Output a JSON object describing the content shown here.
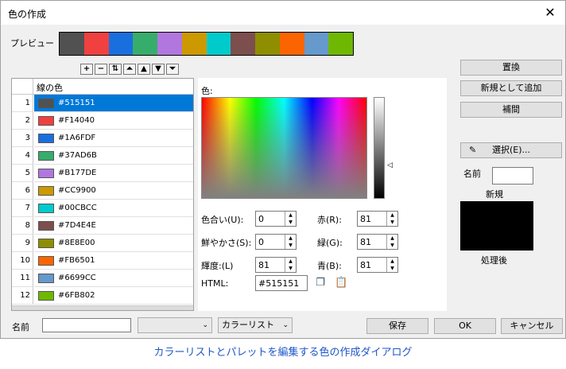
{
  "window": {
    "title": "色の作成",
    "close_glyph": "✕"
  },
  "preview": {
    "label": "プレビュー",
    "swatches": [
      "#515151",
      "#F14040",
      "#1A6FDF",
      "#37AD6B",
      "#B177DE",
      "#CC9900",
      "#00CBCC",
      "#7D4E4E",
      "#8E8E00",
      "#FB6501",
      "#6699CC",
      "#6FB802"
    ]
  },
  "toolbar": [
    "+",
    "−",
    "⇅",
    "⏶",
    "▲",
    "▼",
    "⏷"
  ],
  "list": {
    "header": "線の色",
    "rows": [
      {
        "n": "1",
        "hex": "#515151"
      },
      {
        "n": "2",
        "hex": "#F14040"
      },
      {
        "n": "3",
        "hex": "#1A6FDF"
      },
      {
        "n": "4",
        "hex": "#37AD6B"
      },
      {
        "n": "5",
        "hex": "#B177DE"
      },
      {
        "n": "6",
        "hex": "#CC9900"
      },
      {
        "n": "7",
        "hex": "#00CBCC"
      },
      {
        "n": "8",
        "hex": "#7D4E4E"
      },
      {
        "n": "9",
        "hex": "#8E8E00"
      },
      {
        "n": "10",
        "hex": "#FB6501"
      },
      {
        "n": "11",
        "hex": "#6699CC"
      },
      {
        "n": "12",
        "hex": "#6FB802"
      }
    ],
    "selected_index": 0
  },
  "color_panel": {
    "color_label": "色:",
    "hue_label": "色合い(U):",
    "hue_value": "0",
    "sat_label": "鮮やかさ(S):",
    "sat_value": "0",
    "lum_label": "輝度:(L)",
    "lum_value": "81",
    "red_label": "赤(R):",
    "red_value": "81",
    "green_label": "緑(G):",
    "green_value": "81",
    "blue_label": "青(B):",
    "blue_value": "81",
    "html_label": "HTML:",
    "html_value": "#515151"
  },
  "right": {
    "replace": "置換",
    "add_new": "新規として追加",
    "interpolate": "補間",
    "select": "選択(E)...",
    "name_label": "名前",
    "new_label": "新規",
    "processed_label": "処理後"
  },
  "bottom": {
    "name_label": "名前",
    "name_value": "",
    "combo1": "",
    "combo2": "カラーリスト",
    "save": "保存",
    "ok": "OK",
    "cancel": "キャンセル"
  },
  "caption": "カラーリストとパレットを編集する色の作成ダイアログ"
}
